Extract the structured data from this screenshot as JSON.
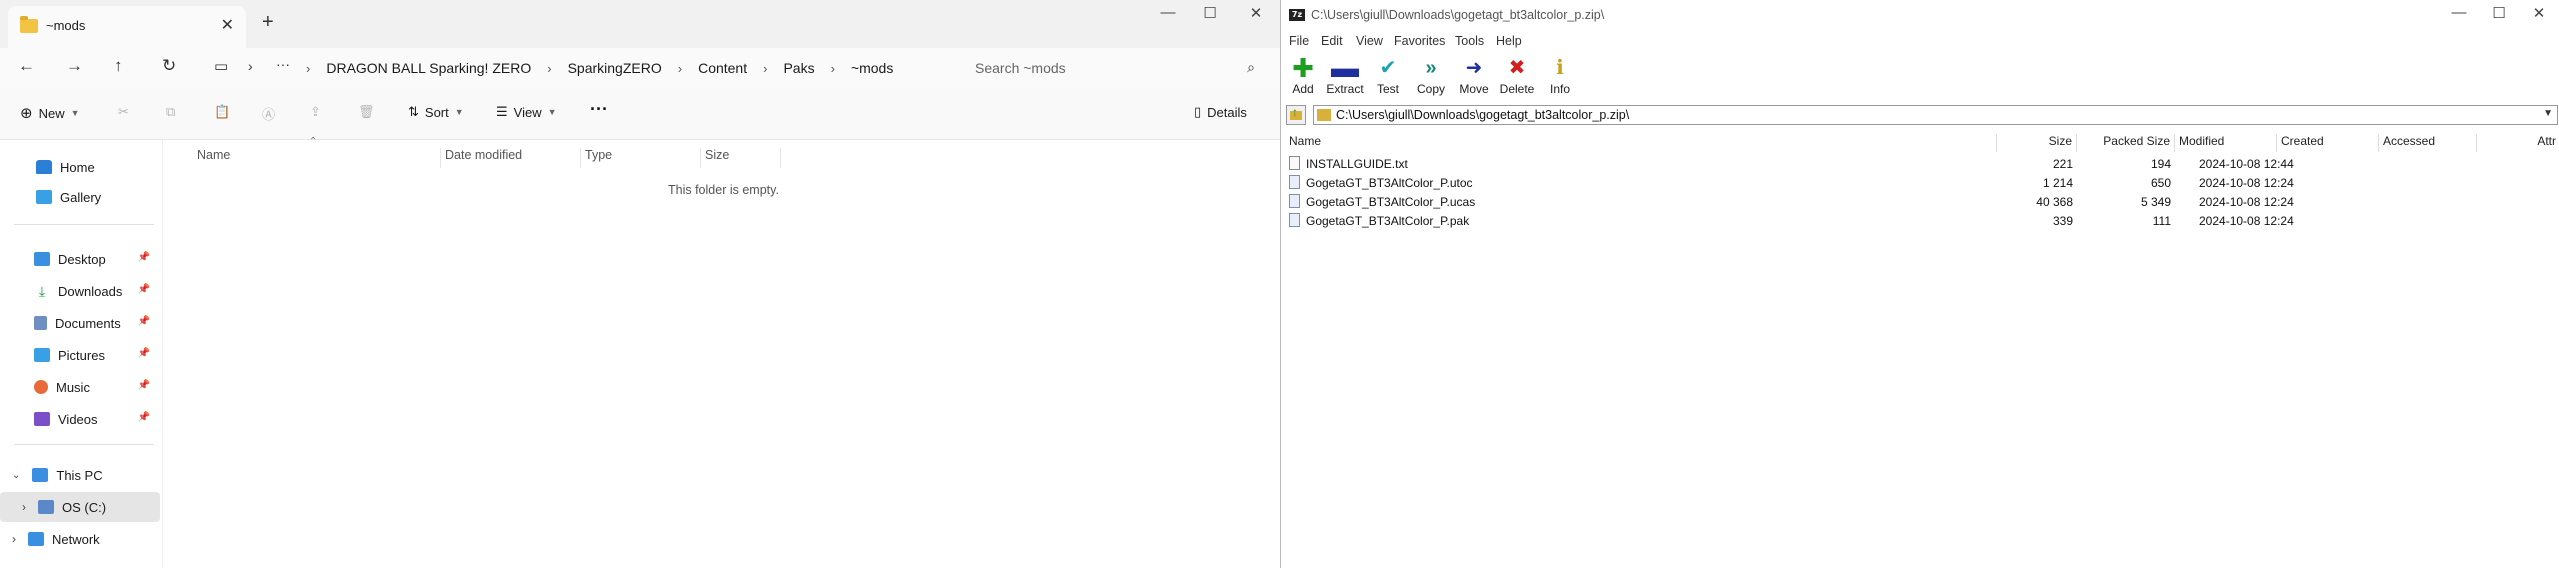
{
  "explorer": {
    "tab_title": "~mods",
    "nav": {
      "breadcrumb": [
        "DRAGON BALL Sparking! ZERO",
        "SparkingZERO",
        "Content",
        "Paks",
        "~mods"
      ],
      "search_placeholder": "Search ~mods"
    },
    "commands": {
      "new": "New",
      "sort": "Sort",
      "view": "View",
      "details": "Details"
    },
    "sidebar": {
      "home": "Home",
      "gallery": "Gallery",
      "desktop": "Desktop",
      "downloads": "Downloads",
      "documents": "Documents",
      "pictures": "Pictures",
      "music": "Music",
      "videos": "Videos",
      "this_pc": "This PC",
      "os_c": "OS (C:)",
      "network": "Network"
    },
    "columns": [
      "Name",
      "Date modified",
      "Type",
      "Size"
    ],
    "empty_message": "This folder is empty."
  },
  "sevenzip": {
    "title": "C:\\Users\\giull\\Downloads\\gogetagt_bt3altcolor_p.zip\\",
    "menu": [
      "File",
      "Edit",
      "View",
      "Favorites",
      "Tools",
      "Help"
    ],
    "toolbar": [
      {
        "label": "Add",
        "icon": "plus-icon",
        "color": "#1e9e1e"
      },
      {
        "label": "Extract",
        "icon": "minus-icon",
        "color": "#1f2f9e"
      },
      {
        "label": "Test",
        "icon": "check-icon",
        "color": "#17a3b0"
      },
      {
        "label": "Copy",
        "icon": "double-arrow-icon",
        "color": "#178a78"
      },
      {
        "label": "Move",
        "icon": "arrow-icon",
        "color": "#1f2f9e"
      },
      {
        "label": "Delete",
        "icon": "x-icon",
        "color": "#d21f1f"
      },
      {
        "label": "Info",
        "icon": "info-icon",
        "color": "#c8a020"
      }
    ],
    "address": "C:\\Users\\giull\\Downloads\\gogetagt_bt3altcolor_p.zip\\",
    "columns": [
      "Name",
      "Size",
      "Packed Size",
      "Modified",
      "Created",
      "Accessed",
      "Attr"
    ],
    "rows": [
      {
        "name": "INSTALLGUIDE.txt",
        "size": "221",
        "packed": "194",
        "modified": "2024-10-08 12:44",
        "type": "txt"
      },
      {
        "name": "GogetaGT_BT3AltColor_P.utoc",
        "size": "1 214",
        "packed": "650",
        "modified": "2024-10-08 12:24",
        "type": "bin"
      },
      {
        "name": "GogetaGT_BT3AltColor_P.ucas",
        "size": "40 368",
        "packed": "5 349",
        "modified": "2024-10-08 12:24",
        "type": "bin"
      },
      {
        "name": "GogetaGT_BT3AltColor_P.pak",
        "size": "339",
        "packed": "111",
        "modified": "2024-10-08 12:24",
        "type": "bin"
      }
    ]
  }
}
